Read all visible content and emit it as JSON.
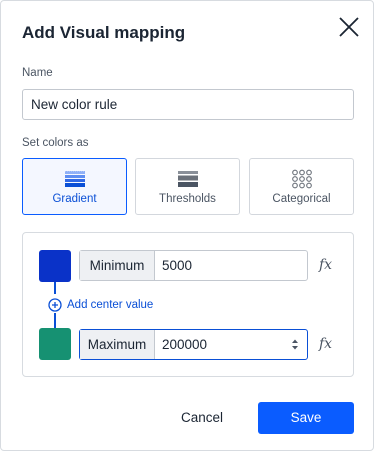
{
  "dialog": {
    "title": "Add Visual mapping",
    "name_label": "Name",
    "name_value": "New color rule",
    "set_colors_label": "Set colors as",
    "options": [
      {
        "label": "Gradient",
        "selected": true,
        "icon": "gradient-icon"
      },
      {
        "label": "Thresholds",
        "selected": false,
        "icon": "thresholds-icon"
      },
      {
        "label": "Categorical",
        "selected": false,
        "icon": "categorical-icon"
      }
    ],
    "minimum": {
      "label": "Minimum",
      "value": "5000",
      "color": "#0a32c8"
    },
    "maximum": {
      "label": "Maximum",
      "value": "200000",
      "color": "#169172"
    },
    "add_center_label": "Add center value",
    "fx_label": "fx",
    "cancel_label": "Cancel",
    "save_label": "Save"
  },
  "colors": {
    "accent": "#0a5cff",
    "link": "#0a4fd6"
  }
}
